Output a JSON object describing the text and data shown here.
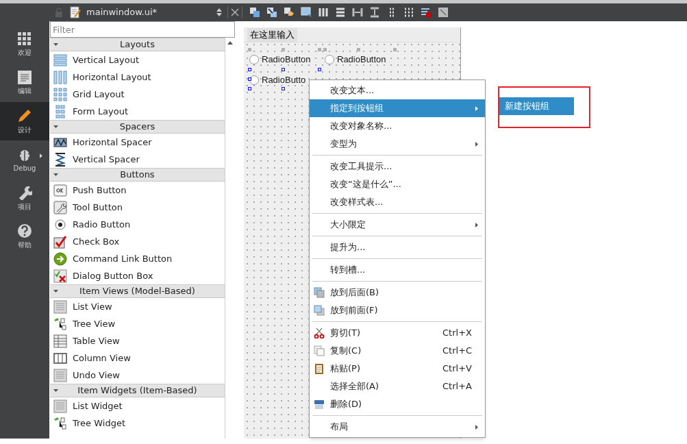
{
  "toolbar": {
    "file_name": "mainwindow.ui*"
  },
  "mode_bar": [
    {
      "label": "欢迎",
      "kind": "welcome",
      "selected": false,
      "expandable": false
    },
    {
      "label": "编辑",
      "kind": "edit",
      "selected": false,
      "expandable": false
    },
    {
      "label": "设计",
      "kind": "design",
      "selected": true,
      "expandable": false
    },
    {
      "label": "Debug",
      "kind": "debug",
      "selected": false,
      "expandable": true
    },
    {
      "label": "项目",
      "kind": "projects",
      "selected": false,
      "expandable": false
    },
    {
      "label": "帮助",
      "kind": "help",
      "selected": false,
      "expandable": false
    }
  ],
  "widget_box": {
    "filter_placeholder": "Filter",
    "sections": [
      {
        "title": "Layouts",
        "expanded": true,
        "items": [
          {
            "label": "Vertical Layout",
            "kind": "vlayout"
          },
          {
            "label": "Horizontal Layout",
            "kind": "hlayout"
          },
          {
            "label": "Grid Layout",
            "kind": "grid"
          },
          {
            "label": "Form Layout",
            "kind": "form"
          }
        ]
      },
      {
        "title": "Spacers",
        "expanded": true,
        "items": [
          {
            "label": "Horizontal Spacer",
            "kind": "hspacer"
          },
          {
            "label": "Vertical Spacer",
            "kind": "vspacer"
          }
        ]
      },
      {
        "title": "Buttons",
        "expanded": true,
        "items": [
          {
            "label": "Push Button",
            "kind": "push"
          },
          {
            "label": "Tool Button",
            "kind": "tool"
          },
          {
            "label": "Radio Button",
            "kind": "radio"
          },
          {
            "label": "Check Box",
            "kind": "check"
          },
          {
            "label": "Command Link Button",
            "kind": "command"
          },
          {
            "label": "Dialog Button Box",
            "kind": "dialog"
          }
        ]
      },
      {
        "title": "Item Views (Model-Based)",
        "expanded": true,
        "items": [
          {
            "label": "List View",
            "kind": "list"
          },
          {
            "label": "Tree View",
            "kind": "tree"
          },
          {
            "label": "Table View",
            "kind": "table"
          },
          {
            "label": "Column View",
            "kind": "column"
          },
          {
            "label": "Undo View",
            "kind": "list"
          }
        ]
      },
      {
        "title": "Item Widgets (Item-Based)",
        "expanded": true,
        "items": [
          {
            "label": "List Widget",
            "kind": "list"
          },
          {
            "label": "Tree Widget",
            "kind": "tree"
          }
        ]
      }
    ]
  },
  "form": {
    "menu_placeholder": "在这里输入",
    "radios": [
      {
        "label": "RadioButton",
        "selected": false,
        "checked": false
      },
      {
        "label": "RadioButton",
        "selected": false,
        "checked": false
      },
      {
        "label": "RadioButto",
        "selected": true,
        "checked": false
      }
    ]
  },
  "context_menu": {
    "items": [
      {
        "kind": "item",
        "label": "改变文本...",
        "selected": false,
        "submenu": false
      },
      {
        "kind": "item",
        "label": "指定到按钮组",
        "selected": true,
        "submenu": true
      },
      {
        "kind": "item",
        "label": "改变对象名称...",
        "selected": false,
        "submenu": false
      },
      {
        "kind": "item",
        "label": "变型为",
        "selected": false,
        "submenu": true
      },
      {
        "kind": "separator"
      },
      {
        "kind": "item",
        "label": "改变工具提示...",
        "selected": false,
        "submenu": false
      },
      {
        "kind": "item",
        "label": "改变“这是什么”...",
        "selected": false,
        "submenu": false
      },
      {
        "kind": "item",
        "label": "改变样式表...",
        "selected": false,
        "submenu": false
      },
      {
        "kind": "separator"
      },
      {
        "kind": "item",
        "label": "大小限定",
        "selected": false,
        "submenu": true
      },
      {
        "kind": "separator"
      },
      {
        "kind": "item",
        "label": "提升为...",
        "selected": false,
        "submenu": false
      },
      {
        "kind": "separator"
      },
      {
        "kind": "item",
        "label": "转到槽...",
        "selected": false,
        "submenu": false
      },
      {
        "kind": "separator"
      },
      {
        "kind": "back",
        "label": "放到后面(B)",
        "selected": false,
        "submenu": false
      },
      {
        "kind": "front",
        "label": "放到前面(F)",
        "selected": false,
        "submenu": false
      },
      {
        "kind": "separator"
      },
      {
        "kind": "cut",
        "label": "剪切(T)",
        "shortcut": "Ctrl+X",
        "selected": false,
        "submenu": false
      },
      {
        "kind": "copy",
        "label": "复制(C)",
        "shortcut": "Ctrl+C",
        "selected": false,
        "submenu": false
      },
      {
        "kind": "paste",
        "label": "粘贴(P)",
        "shortcut": "Ctrl+V",
        "selected": false,
        "submenu": false
      },
      {
        "kind": "item",
        "label": "选择全部(A)",
        "shortcut": "Ctrl+A",
        "selected": false,
        "submenu": false
      },
      {
        "kind": "delete",
        "label": "删除(D)",
        "selected": false,
        "submenu": false
      },
      {
        "kind": "separator"
      },
      {
        "kind": "item",
        "label": "布局",
        "selected": false,
        "submenu": true
      }
    ],
    "submenu": [
      {
        "label": "新建按钮组",
        "selected": true
      }
    ]
  }
}
